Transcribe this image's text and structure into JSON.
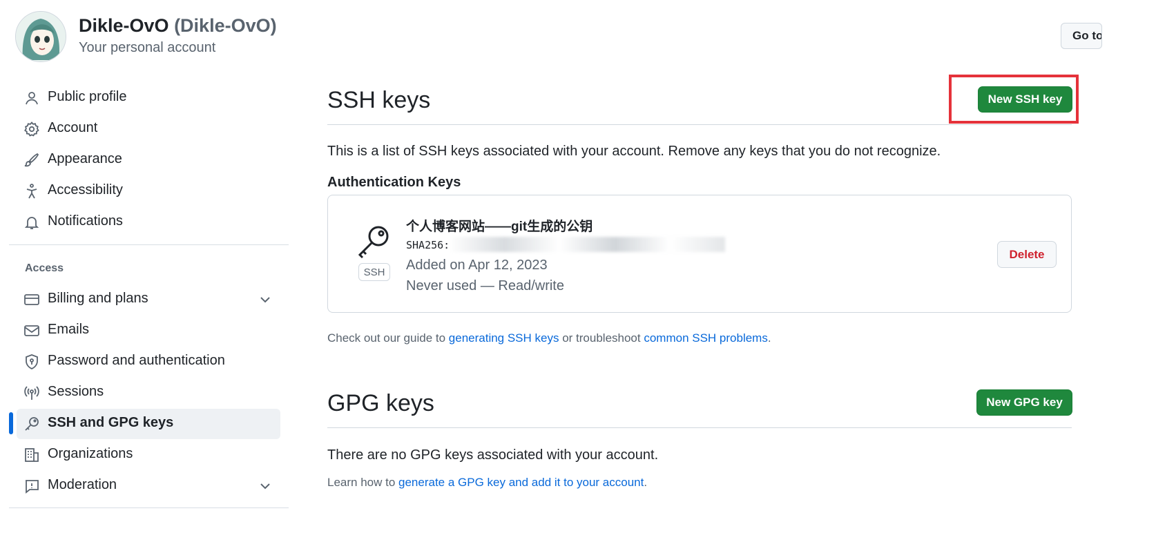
{
  "user": {
    "name": "Dikle-OvO",
    "login": "(Dikle-OvO)",
    "subtitle": "Your personal account"
  },
  "header": {
    "go_button": "Go to your personal profile"
  },
  "sidebar": {
    "items": [
      {
        "label": "Public profile",
        "icon": "person-icon"
      },
      {
        "label": "Account",
        "icon": "gear-icon"
      },
      {
        "label": "Appearance",
        "icon": "paintbrush-icon"
      },
      {
        "label": "Accessibility",
        "icon": "accessibility-icon"
      },
      {
        "label": "Notifications",
        "icon": "bell-icon"
      }
    ],
    "access_heading": "Access",
    "access_items": [
      {
        "label": "Billing and plans",
        "icon": "credit-card-icon",
        "expandable": true
      },
      {
        "label": "Emails",
        "icon": "mail-icon"
      },
      {
        "label": "Password and authentication",
        "icon": "shield-lock-icon"
      },
      {
        "label": "Sessions",
        "icon": "broadcast-icon"
      },
      {
        "label": "SSH and GPG keys",
        "icon": "key-icon",
        "active": true
      },
      {
        "label": "Organizations",
        "icon": "organization-icon"
      },
      {
        "label": "Moderation",
        "icon": "report-icon",
        "expandable": true
      }
    ]
  },
  "ssh": {
    "title": "SSH keys",
    "new_button": "New SSH key",
    "description": "This is a list of SSH keys associated with your account. Remove any keys that you do not recognize.",
    "auth_heading": "Authentication Keys",
    "keys": [
      {
        "title": "个人博客网站——git生成的公钥",
        "fingerprint": "SHA256:",
        "badge": "SSH",
        "added": "Added on Apr 12, 2023",
        "usage": "Never used — Read/write",
        "delete_label": "Delete"
      }
    ],
    "guide_prefix": "Check out our guide to ",
    "guide_link1": "generating SSH keys",
    "guide_middle": " or troubleshoot ",
    "guide_link2": "common SSH problems",
    "guide_suffix": "."
  },
  "gpg": {
    "title": "GPG keys",
    "new_button": "New GPG key",
    "empty_text": "There are no GPG keys associated with your account.",
    "learn_prefix": "Learn how to ",
    "learn_link": "generate a GPG key and add it to your account",
    "learn_suffix": "."
  },
  "colors": {
    "accent_green": "#1f883d",
    "link_blue": "#0969da",
    "highlight_red": "#e5323a",
    "danger_red": "#cf222e"
  }
}
